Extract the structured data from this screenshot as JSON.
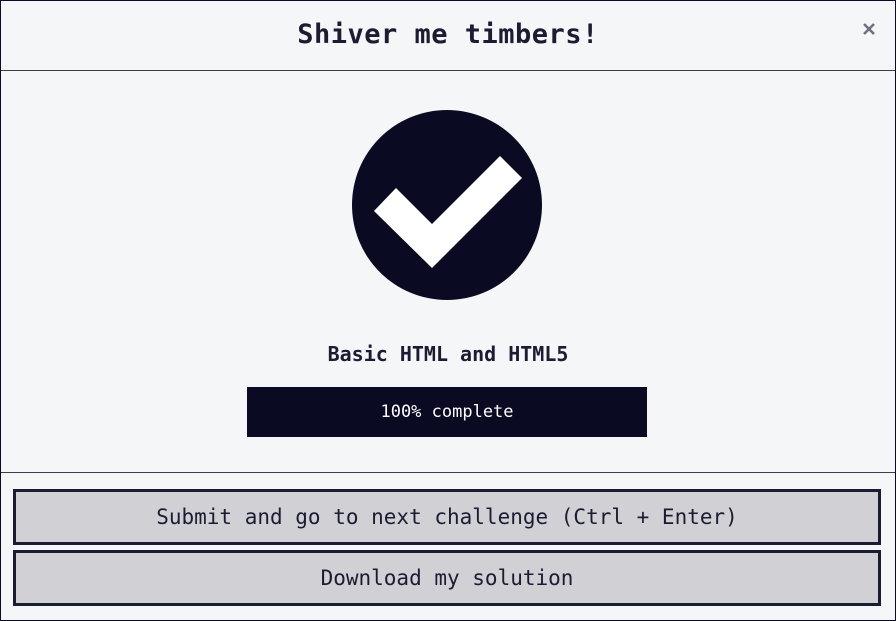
{
  "modal": {
    "title": "Shiver me timbers!",
    "close_label": "×"
  },
  "completion": {
    "icon": "check-circle-icon",
    "block_title": "Basic HTML and HTML5",
    "progress_percent": 100,
    "progress_label": "100% complete"
  },
  "actions": {
    "submit_label": "Submit and go to next challenge (Ctrl + Enter)",
    "download_label": "Download my solution"
  },
  "colors": {
    "primary_dark": "#0a0a23",
    "background": "#f5f6f7",
    "button_bg": "#d0d0d5",
    "button_border": "#1b1b32"
  }
}
